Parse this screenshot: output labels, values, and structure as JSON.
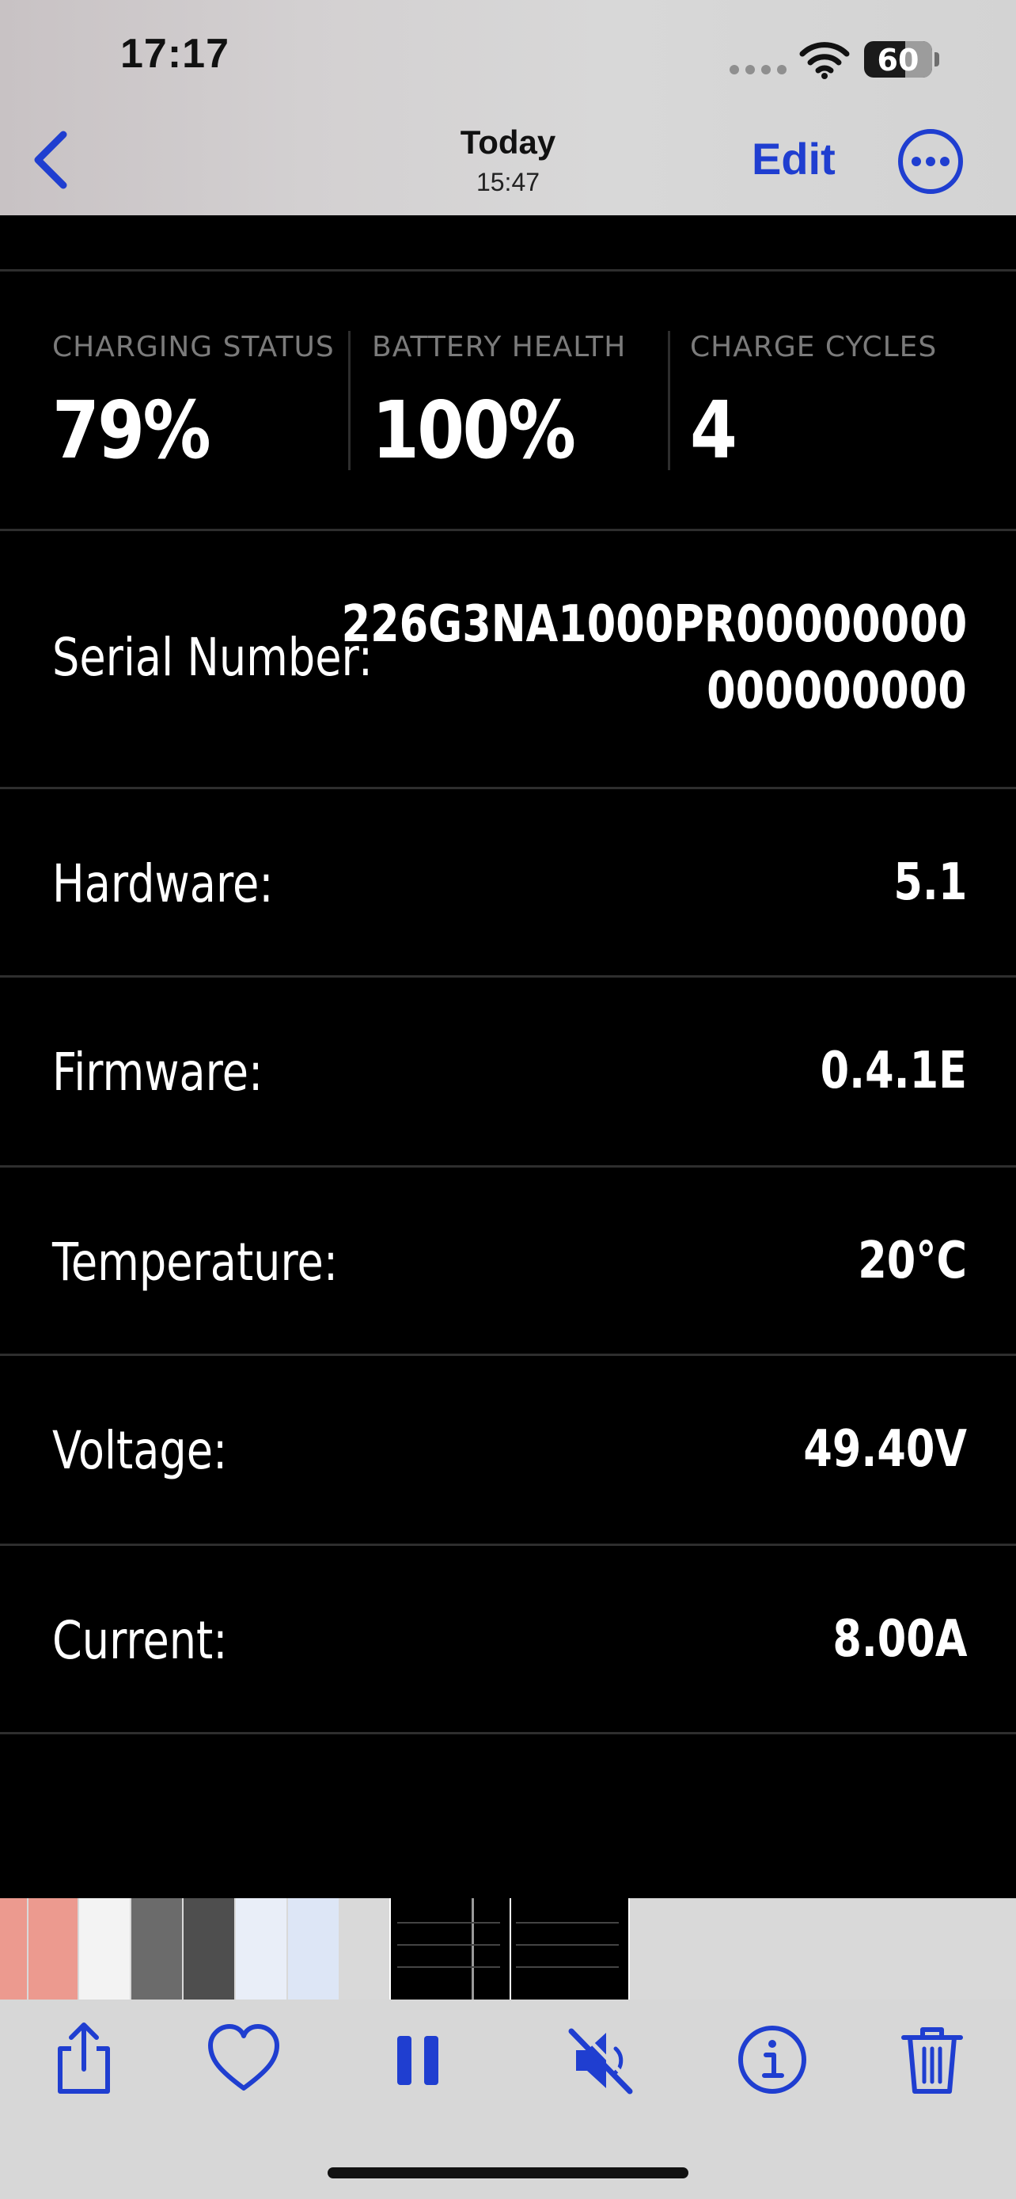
{
  "status_bar": {
    "time": "17:17",
    "battery_level": "60"
  },
  "nav": {
    "title": "Today",
    "subtitle": "15:47",
    "edit_label": "Edit",
    "back_icon": "chevron-left-icon",
    "more_icon": "ellipsis-circle-icon"
  },
  "stats": [
    {
      "label": "CHARGING STATUS",
      "value": "79%"
    },
    {
      "label": "BATTERY HEALTH",
      "value": "100%"
    },
    {
      "label": "CHARGE CYCLES",
      "value": "4"
    }
  ],
  "serial": {
    "label": "Serial Number:",
    "value_line1": "226G3NA1000PR00000000",
    "value_line2": "000000000"
  },
  "details": [
    {
      "label": "Hardware:",
      "value": "5.1"
    },
    {
      "label": "Firmware:",
      "value": "0.4.1E"
    },
    {
      "label": "Temperature:",
      "value": "20°C"
    },
    {
      "label": "Voltage:",
      "value": "49.40V"
    },
    {
      "label": "Current:",
      "value": "8.00A"
    }
  ],
  "toolbar": {
    "icons": [
      "share-icon",
      "heart-icon",
      "pause-icon",
      "speaker-muted-icon",
      "info-icon",
      "trash-icon"
    ]
  },
  "colors": {
    "accent": "#1f3ed0",
    "background": "#000000",
    "bar": "#d7d7d7"
  }
}
